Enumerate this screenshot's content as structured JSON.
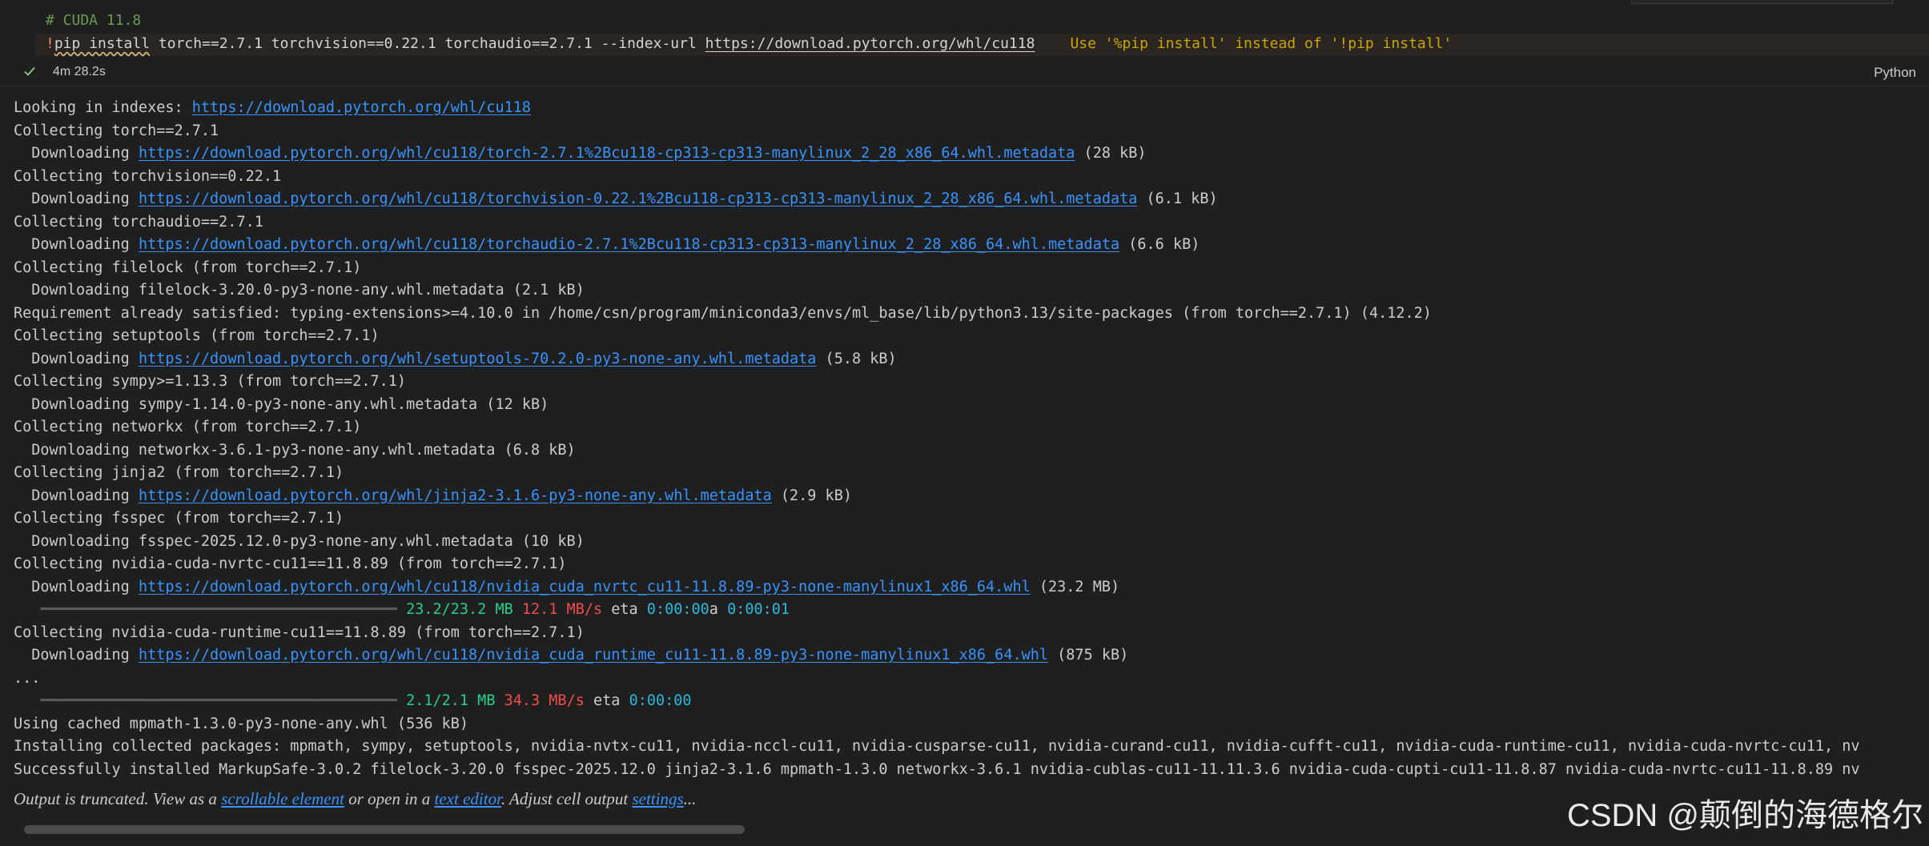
{
  "code_cell": {
    "comment": "# CUDA 11.8",
    "cmd_bang": "!",
    "cmd_pip": "pip install",
    "cmd_args": " torch==2.7.1 torchvision==0.22.1 torchaudio==2.7.1 --index-url ",
    "cmd_url": "https://download.pytorch.org/whl/cu118",
    "warning": "Use '%pip install' instead of '!pip install'"
  },
  "status": {
    "duration": "4m 28.2s",
    "language": "Python",
    "icon": "check-icon"
  },
  "output": {
    "lines": [
      {
        "pre": "Looking in indexes: ",
        "link": "https://download.pytorch.org/whl/cu118",
        "post": ""
      },
      {
        "pre": "Collecting torch==2.7.1",
        "link": "",
        "post": ""
      },
      {
        "pre": "  Downloading ",
        "link": "https://download.pytorch.org/whl/cu118/torch-2.7.1%2Bcu118-cp313-cp313-manylinux_2_28_x86_64.whl.metadata",
        "post": " (28 kB)"
      },
      {
        "pre": "Collecting torchvision==0.22.1",
        "link": "",
        "post": ""
      },
      {
        "pre": "  Downloading ",
        "link": "https://download.pytorch.org/whl/cu118/torchvision-0.22.1%2Bcu118-cp313-cp313-manylinux_2_28_x86_64.whl.metadata",
        "post": " (6.1 kB)"
      },
      {
        "pre": "Collecting torchaudio==2.7.1",
        "link": "",
        "post": ""
      },
      {
        "pre": "  Downloading ",
        "link": "https://download.pytorch.org/whl/cu118/torchaudio-2.7.1%2Bcu118-cp313-cp313-manylinux_2_28_x86_64.whl.metadata",
        "post": " (6.6 kB)"
      },
      {
        "pre": "Collecting filelock (from torch==2.7.1)",
        "link": "",
        "post": ""
      },
      {
        "pre": "  Downloading filelock-3.20.0-py3-none-any.whl.metadata (2.1 kB)",
        "link": "",
        "post": ""
      },
      {
        "pre": "Requirement already satisfied: typing-extensions>=4.10.0 in /home/csn/program/miniconda3/envs/ml_base/lib/python3.13/site-packages (from torch==2.7.1) (4.12.2)",
        "link": "",
        "post": ""
      },
      {
        "pre": "Collecting setuptools (from torch==2.7.1)",
        "link": "",
        "post": ""
      },
      {
        "pre": "  Downloading ",
        "link": "https://download.pytorch.org/whl/setuptools-70.2.0-py3-none-any.whl.metadata",
        "post": " (5.8 kB)"
      },
      {
        "pre": "Collecting sympy>=1.13.3 (from torch==2.7.1)",
        "link": "",
        "post": ""
      },
      {
        "pre": "  Downloading sympy-1.14.0-py3-none-any.whl.metadata (12 kB)",
        "link": "",
        "post": ""
      },
      {
        "pre": "Collecting networkx (from torch==2.7.1)",
        "link": "",
        "post": ""
      },
      {
        "pre": "  Downloading networkx-3.6.1-py3-none-any.whl.metadata (6.8 kB)",
        "link": "",
        "post": ""
      },
      {
        "pre": "Collecting jinja2 (from torch==2.7.1)",
        "link": "",
        "post": ""
      },
      {
        "pre": "  Downloading ",
        "link": "https://download.pytorch.org/whl/jinja2-3.1.6-py3-none-any.whl.metadata",
        "post": " (2.9 kB)"
      },
      {
        "pre": "Collecting fsspec (from torch==2.7.1)",
        "link": "",
        "post": ""
      },
      {
        "pre": "  Downloading fsspec-2025.12.0-py3-none-any.whl.metadata (10 kB)",
        "link": "",
        "post": ""
      },
      {
        "pre": "Collecting nvidia-cuda-nvrtc-cu11==11.8.89 (from torch==2.7.1)",
        "link": "",
        "post": ""
      },
      {
        "pre": "  Downloading ",
        "link": "https://download.pytorch.org/whl/cu118/nvidia_cuda_nvrtc_cu11-11.8.89-py3-none-manylinux1_x86_64.whl",
        "post": " (23.2 MB)"
      },
      {
        "progress": {
          "bar": "   ━━━━━━━━━━━━━━━━━━━━━━━━━━━━━━━━━━━━━━━━ ",
          "done": "23.2/23.2 MB",
          "rate": "12.1 MB/s",
          "eta_label": " eta ",
          "eta": "0:00:00",
          "extra_plain": "a ",
          "extra_time": "0:00:01"
        }
      },
      {
        "pre": "Collecting nvidia-cuda-runtime-cu11==11.8.89 (from torch==2.7.1)",
        "link": "",
        "post": ""
      },
      {
        "pre": "  Downloading ",
        "link": "https://download.pytorch.org/whl/cu118/nvidia_cuda_runtime_cu11-11.8.89-py3-none-manylinux1_x86_64.whl",
        "post": " (875 kB)"
      },
      {
        "pre": "...",
        "link": "",
        "post": ""
      },
      {
        "progress": {
          "bar": "   ━━━━━━━━━━━━━━━━━━━━━━━━━━━━━━━━━━━━━━━━ ",
          "done": "2.1/2.1 MB",
          "rate": "34.3 MB/s",
          "eta_label": " eta ",
          "eta": "0:00:00",
          "extra_plain": "",
          "extra_time": ""
        }
      },
      {
        "pre": "Using cached mpmath-1.3.0-py3-none-any.whl (536 kB)",
        "link": "",
        "post": ""
      },
      {
        "pre": "Installing collected packages: mpmath, sympy, setuptools, nvidia-nvtx-cu11, nvidia-nccl-cu11, nvidia-cusparse-cu11, nvidia-curand-cu11, nvidia-cufft-cu11, nvidia-cuda-runtime-cu11, nvidia-cuda-nvrtc-cu11, nv",
        "link": "",
        "post": ""
      },
      {
        "pre": "Successfully installed MarkupSafe-3.0.2 filelock-3.20.0 fsspec-2025.12.0 jinja2-3.1.6 mpmath-1.3.0 networkx-3.6.1 nvidia-cublas-cu11-11.11.3.6 nvidia-cuda-cupti-cu11-11.8.87 nvidia-cuda-nvrtc-cu11-11.8.89 nv",
        "link": "",
        "post": ""
      }
    ],
    "truncation": {
      "prefix": "Output is truncated. View as a ",
      "link1": "scrollable element",
      "mid1": " or open in a ",
      "link2": "text editor",
      "mid2": ". Adjust cell output ",
      "link3": "settings",
      "suffix": "..."
    }
  },
  "watermark": "CSDN @颠倒的海德格尔",
  "colors": {
    "background": "#1f1f1f",
    "link": "#3794ff",
    "comment": "#6a9955",
    "warning": "#cca700",
    "progress_done": "#23d18b",
    "progress_rate": "#f14c4c",
    "progress_eta": "#29b8db"
  }
}
